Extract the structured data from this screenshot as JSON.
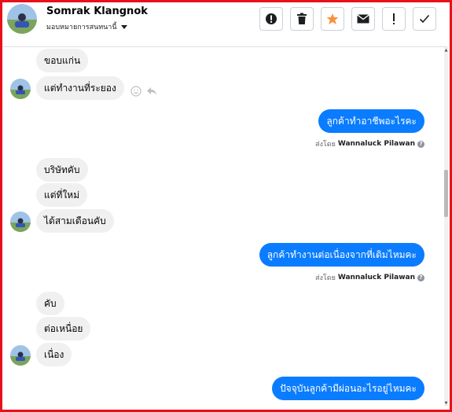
{
  "header": {
    "name": "Somrak Klangnok",
    "assign_label": "มอบหมายการสนทนานี้"
  },
  "toolbar": {
    "icons": [
      "alert-circle-icon",
      "trash-icon",
      "star-icon",
      "envelope-icon",
      "exclamation-icon",
      "checkmark-icon"
    ],
    "accent_color": "#f7923a"
  },
  "colors": {
    "outgoing": "#0a7cff",
    "incoming": "#f0f0f0",
    "frame": "#e8101a"
  },
  "messages": {
    "m1": "ขอบแก่น",
    "m2": "แต่ทำงานที่ระยอง",
    "m3": "ลูกค้าทำอาชีพอะไรคะ",
    "m4": "บริษัทคับ",
    "m5": "แต่ที่ใหม่",
    "m6": "ได้สามเดือนคับ",
    "m7": "ลูกค้าทำงานต่อเนื่องจากที่เดิมไหมคะ",
    "m8": "คับ",
    "m9": "ต่อเหนื่อย",
    "m10": "เนื่อง",
    "m11": "ปัจจุบันลูกค้ามีผ่อนอะไรอยู่ไหมคะ"
  },
  "sent_by": {
    "prefix": "ส่งโดย",
    "agent": "Wannaluck Pilawan",
    "help": "?"
  }
}
